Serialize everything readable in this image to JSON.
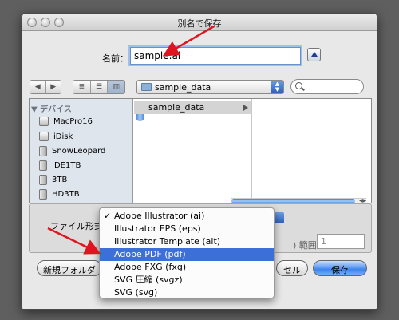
{
  "window": {
    "title": "別名で保存"
  },
  "name_row": {
    "label": "名前：",
    "value": "sample.ai"
  },
  "toolbar": {
    "back_glyph": "◀",
    "forward_glyph": "▶",
    "view_icon": "≣",
    "view_list": "☰",
    "view_columns": "▥",
    "location": "sample_data"
  },
  "sidebar": {
    "header": "▼ デバイス",
    "items": [
      {
        "label": "MacPro16",
        "icon": "computer-icon"
      },
      {
        "label": "iDisk",
        "icon": "idisk-icon"
      },
      {
        "label": "SnowLeopard",
        "icon": "drive-icon"
      },
      {
        "label": "IDE1TB",
        "icon": "drive-icon"
      },
      {
        "label": "3TB",
        "icon": "drive-icon"
      },
      {
        "label": "HD3TB",
        "icon": "drive-icon"
      }
    ]
  },
  "browser": {
    "column_item": "sample_data"
  },
  "format": {
    "label": "ファイル形式",
    "options": [
      {
        "label": "Adobe Illustrator (ai)",
        "checked": true
      },
      {
        "label": "Illustrator EPS (eps)"
      },
      {
        "label": "Illustrator Template (ait)"
      },
      {
        "label": "Adobe PDF (pdf)",
        "highlighted": true
      },
      {
        "label": "Adobe FXG (fxg)"
      },
      {
        "label": "SVG 圧縮 (svgz)"
      },
      {
        "label": "SVG (svg)"
      }
    ],
    "check_mark": "✓"
  },
  "range": {
    "label": ") 範囲：",
    "value": "1"
  },
  "buttons": {
    "new_folder": "新規フォルダ",
    "cancel": "セル",
    "save": "保存"
  },
  "colors": {
    "highlight": "#3d6fd8",
    "arrow": "#e0141e"
  }
}
